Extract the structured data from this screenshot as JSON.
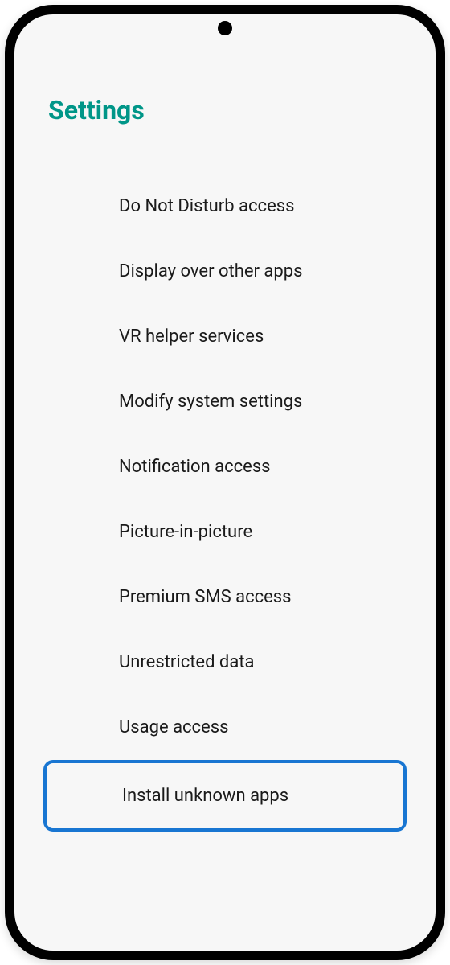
{
  "header": {
    "title": "Settings"
  },
  "items": [
    {
      "label": "Do Not Disturb access",
      "highlighted": false
    },
    {
      "label": "Display over other apps",
      "highlighted": false
    },
    {
      "label": "VR helper services",
      "highlighted": false
    },
    {
      "label": "Modify system settings",
      "highlighted": false
    },
    {
      "label": "Notification access",
      "highlighted": false
    },
    {
      "label": "Picture-in-picture",
      "highlighted": false
    },
    {
      "label": "Premium SMS access",
      "highlighted": false
    },
    {
      "label": "Unrestricted data",
      "highlighted": false
    },
    {
      "label": "Usage access",
      "highlighted": false
    },
    {
      "label": "Install unknown apps",
      "highlighted": true
    }
  ]
}
